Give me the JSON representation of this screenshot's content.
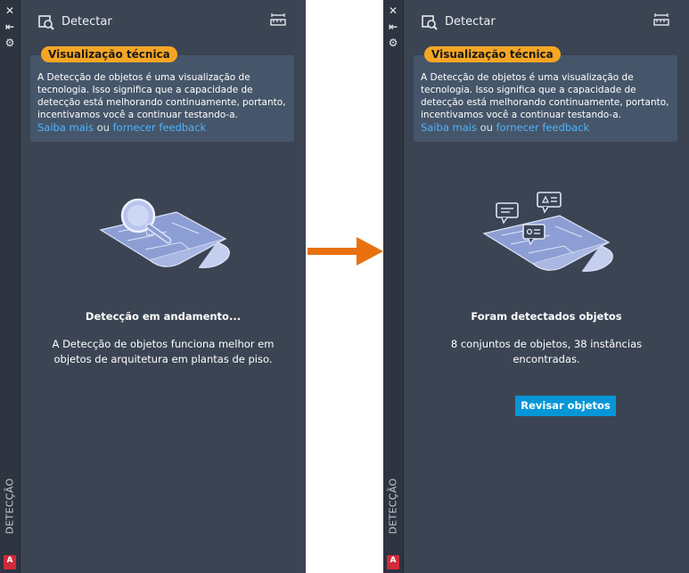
{
  "panels": [
    {
      "header": {
        "title": "Detectar"
      },
      "badge": "Visualização técnica",
      "note": {
        "text": "A Detecção de objetos é uma visualização de tecnologia. Isso significa que a capacidade de detecção está melhorando continuamente, portanto, incentivamos você a continuar testando-a.",
        "link1": "Saiba mais",
        "or": "ou",
        "link2": "fornecer feedback"
      },
      "status": {
        "title": "Detecção em andamento...",
        "description": "A Detecção de objetos funciona melhor em objetos de arquitetura em plantas de piso."
      },
      "side_label": "DETECÇÃO"
    },
    {
      "header": {
        "title": "Detectar"
      },
      "badge": "Visualização técnica",
      "note": {
        "text": "A Detecção de objetos é uma visualização de tecnologia. Isso significa que a capacidade de detecção está melhorando continuamente, portanto, incentivamos você a continuar testando-a.",
        "link1": "Saiba mais",
        "or": "ou",
        "link2": "fornecer feedback"
      },
      "status": {
        "title": "Foram detectados objetos",
        "description": "8 conjuntos de objetos, 38 instâncias encontradas."
      },
      "button": "Revisar objetos",
      "side_label": "DETECÇÃO"
    }
  ],
  "colors": {
    "panel_bg": "#3b4453",
    "badge": "#f5a623",
    "link": "#4fb3ff",
    "button": "#0696d7",
    "arrow": "#e8700f"
  }
}
